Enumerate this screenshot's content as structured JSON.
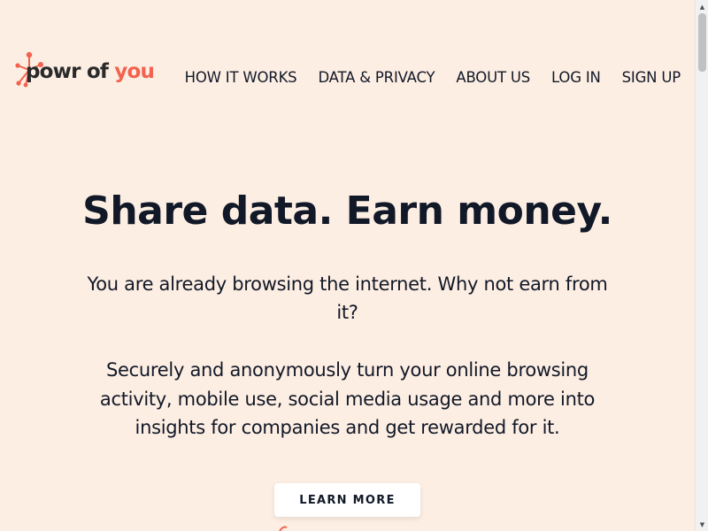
{
  "brand": {
    "logo_part1": "powr of",
    "logo_part2": " you",
    "color_dark": "#2a2a2a",
    "color_accent": "#f2624e"
  },
  "nav": {
    "items": [
      {
        "label": "HOW IT WORKS"
      },
      {
        "label": "DATA & PRIVACY"
      },
      {
        "label": "ABOUT US"
      },
      {
        "label": "LOG IN"
      },
      {
        "label": "SIGN UP"
      }
    ]
  },
  "hero": {
    "title": "Share data. Earn money.",
    "subtitle": "You are already browsing the internet. Why not earn from it?",
    "description": "Securely and anonymously turn your online browsing activity, mobile use, social media usage and more into insights for companies and get rewarded for it.",
    "cta_label": "LEARN MORE"
  },
  "theme": {
    "background": "#fdeee3",
    "text": "#111827",
    "button_bg": "#ffffff"
  },
  "icons": {
    "logo_mark": "molecule-network-icon",
    "peek": "orange-graphic-icon",
    "scroll_up": "arrow-up-icon",
    "scroll_down": "arrow-down-icon"
  }
}
